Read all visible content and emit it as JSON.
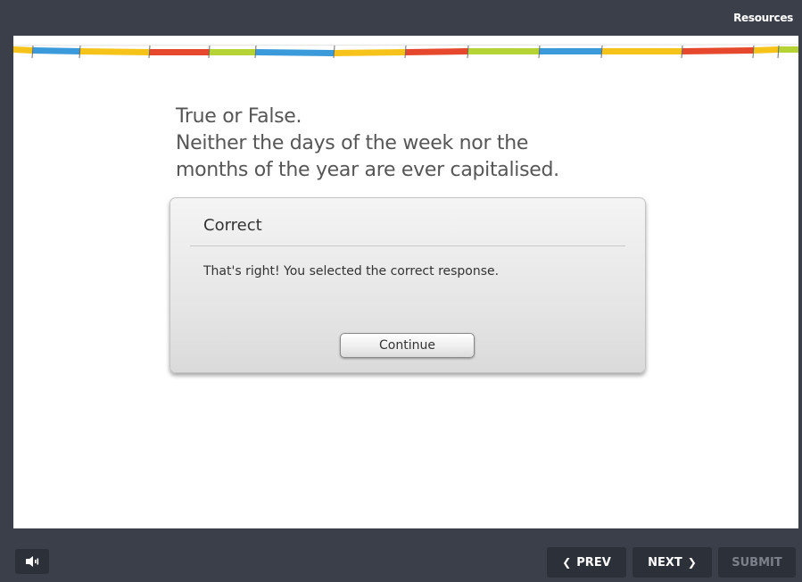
{
  "header": {
    "resources_label": "Resources"
  },
  "question": {
    "lines": [
      "True or False.",
      "Neither the days of the week nor the",
      "months of the year are ever capitalised."
    ]
  },
  "feedback": {
    "title": "Correct",
    "message": "That's right!  You selected the correct response.",
    "continue_label": "Continue"
  },
  "footer": {
    "audio_icon": "speaker-icon",
    "prev_label": "PREV",
    "next_label": "NEXT",
    "submit_label": "SUBMIT",
    "submit_enabled": false
  },
  "colors": {
    "frame": "#3b3f4a",
    "button_dark": "#2c3038",
    "ribbon_yellow": "#f5c319",
    "ribbon_red": "#e5482c",
    "ribbon_blue": "#3b9ad9",
    "ribbon_green": "#b5d334"
  }
}
